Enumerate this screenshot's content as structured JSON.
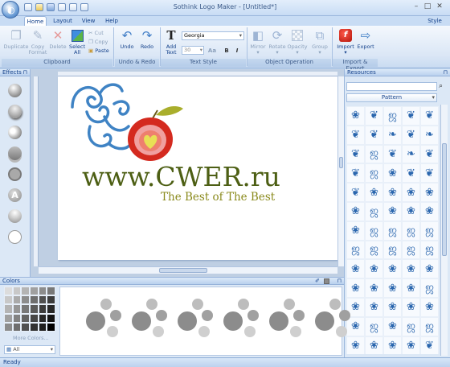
{
  "window": {
    "title": "Sothink Logo Maker - [Untitled*]"
  },
  "tabs": [
    {
      "label": "Home"
    },
    {
      "label": "Layout"
    },
    {
      "label": "View"
    },
    {
      "label": "Help"
    }
  ],
  "style_menu": "Style",
  "ribbon": {
    "clipboard": {
      "label": "Clipboard",
      "duplicate": "Duplicate",
      "copy_format_line1": "Copy",
      "copy_format_line2": "Format",
      "delete": "Delete",
      "select_all_line1": "Select",
      "select_all_line2": "All",
      "cut": "Cut",
      "copy": "Copy",
      "paste": "Paste"
    },
    "undo_redo": {
      "label": "Undo & Redo",
      "undo": "Undo",
      "redo": "Redo"
    },
    "text_style": {
      "label": "Text Style",
      "add_text_line1": "Add",
      "add_text_line2": "Text",
      "font": "Georgia",
      "size": "30",
      "bold": "B",
      "italic": "I"
    },
    "object_operation": {
      "label": "Object Operation",
      "mirror": "Mirror",
      "rotate": "Rotate",
      "opacity": "Opacity",
      "group": "Group"
    },
    "import_export": {
      "label": "Import & Export",
      "import": "Import",
      "export": "Export"
    }
  },
  "effects_panel": {
    "title": "Effects"
  },
  "canvas": {
    "domain_text": "www.CWER.ru",
    "tagline": "The Best of The Best",
    "colors": {
      "domain": "#4d5f14",
      "tagline": "#8a8a1c",
      "swirl": "#3f83c4",
      "apple": "#d42a1f",
      "leaf": "#9ea52a"
    }
  },
  "resources_panel": {
    "title": "Resources",
    "search_placeholder": "",
    "category": "Pattern",
    "patterns": [
      "flower-icon",
      "leaf-icon",
      "swirl-icon",
      "leaf-icon",
      "leaf-icon",
      "leaf-icon",
      "leaf-icon",
      "drop-icon",
      "leaf-icon",
      "drop-icon",
      "leaf-icon",
      "swirl-icon",
      "leaf-icon",
      "drop-icon",
      "leaf-icon",
      "leaf-icon",
      "swirl-icon",
      "flower-icon",
      "leaf-icon",
      "leaf-icon",
      "leaf-icon",
      "flower-icon",
      "flower-icon",
      "flower-icon",
      "flower-icon",
      "flower-icon",
      "swirl-icon",
      "flower-icon",
      "flower-icon",
      "flower-icon",
      "flower-icon",
      "swirl-icon",
      "swirl-icon",
      "swirl-icon",
      "swirl-icon",
      "swirl-icon",
      "swirl-icon",
      "swirl-icon",
      "swirl-icon",
      "swirl-icon",
      "flower-icon",
      "flower-icon",
      "flower-icon",
      "flower-icon",
      "flower-icon",
      "flower-icon",
      "flower-icon",
      "flower-icon",
      "flower-icon",
      "swirl-icon",
      "flower-icon",
      "flower-icon",
      "flower-icon",
      "flower-icon",
      "flower-icon",
      "flower-icon",
      "swirl-icon",
      "flower-icon",
      "swirl-icon",
      "swirl-icon",
      "flower-icon",
      "flower-icon",
      "flower-icon",
      "flower-icon",
      "leaf-icon"
    ]
  },
  "colors_panel": {
    "title": "Colors",
    "more_colors": "More Colors...",
    "filter": "All",
    "swatches": [
      "#dcdcdc",
      "#c8c8c8",
      "#b4b4b4",
      "#a0a0a0",
      "#8c8c8c",
      "#787878",
      "#c8c8c8",
      "#aaaaaa",
      "#8c8c8c",
      "#6e6e6e",
      "#505050",
      "#3c3c3c",
      "#b4b4b4",
      "#969696",
      "#787878",
      "#5a5a5a",
      "#3c3c3c",
      "#282828",
      "#a0a0a0",
      "#828282",
      "#646464",
      "#464646",
      "#282828",
      "#141414",
      "#8c8c8c",
      "#6e6e6e",
      "#505050",
      "#323232",
      "#1e1e1e",
      "#000000"
    ]
  },
  "status": "Ready"
}
